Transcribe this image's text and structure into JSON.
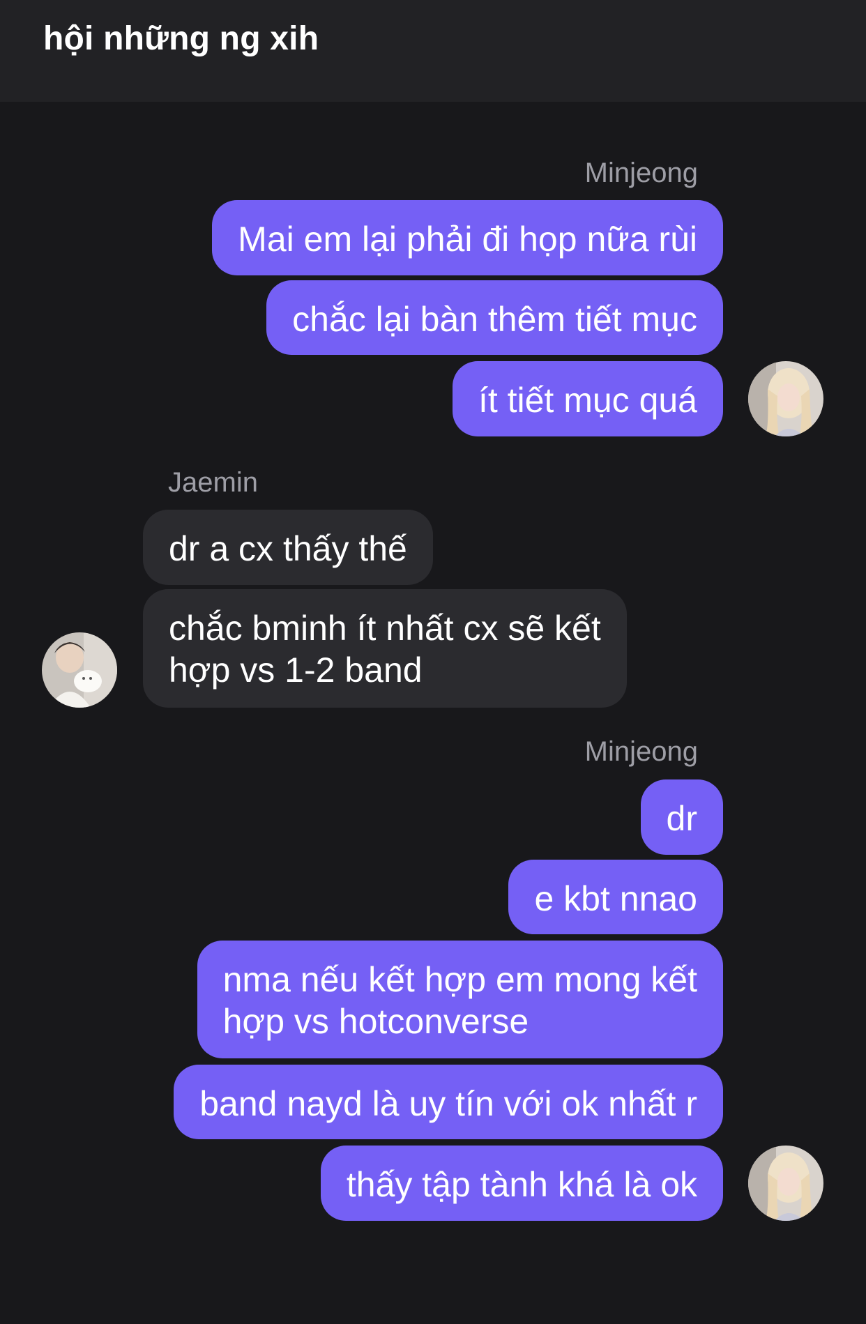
{
  "header": {
    "title": "hội những ng xih"
  },
  "groups": [
    {
      "sender": "Minjeong",
      "messages": [
        "Mai em lại phải đi họp nữa rùi",
        "chắc lại bàn thêm tiết mục",
        "ít tiết mục quá"
      ]
    },
    {
      "sender": "Jaemin",
      "messages": [
        "dr a cx thấy thế",
        "chắc bminh ít nhất cx sẽ kết\nhợp vs 1-2 band"
      ]
    },
    {
      "sender": "Minjeong",
      "messages": [
        "dr",
        "e kbt nnao",
        "nma nếu kết hợp em mong kết\nhợp vs hotconverse",
        "band nayd là uy tín với ok nhất r",
        "thấy tập tành khá là ok"
      ]
    }
  ],
  "colors": {
    "background": "#18181b",
    "header_background": "#222225",
    "outgoing_bubble": "#7560f5",
    "incoming_bubble": "#2b2b2f",
    "sender_label": "#9e9ea6"
  },
  "avatars": {
    "minjeong": "avatar-photo-blonde-girl",
    "jaemin": "avatar-photo-boy-with-cat"
  }
}
